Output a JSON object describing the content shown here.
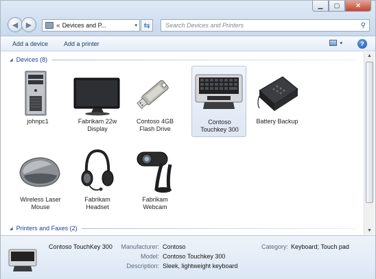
{
  "address": {
    "path_separator": "«",
    "path_text": "Devices and P...",
    "dropdown_glyph": "▾"
  },
  "search": {
    "placeholder": "Search Devices and Printers"
  },
  "toolbar": {
    "add_device": "Add a device",
    "add_printer": "Add a printer",
    "help_glyph": "?"
  },
  "groups": {
    "devices": "Devices (8)",
    "printers": "Printers and Faxes (2)"
  },
  "devices": [
    {
      "label": "johnpc1",
      "icon": "computer-tower-icon"
    },
    {
      "label": "Fabrikam 22w\nDisplay",
      "icon": "monitor-icon"
    },
    {
      "label": "Contoso 4GB\nFlash Drive",
      "icon": "usb-flash-drive-icon"
    },
    {
      "label": "Contoso\nTouchkey 300",
      "icon": "keyboard-icon",
      "selected": true
    },
    {
      "label": "Battery Backup",
      "icon": "ups-battery-icon"
    },
    {
      "label": "Wireless Laser\nMouse",
      "icon": "mouse-icon"
    },
    {
      "label": "Fabrikam\nHeadset",
      "icon": "headset-icon"
    },
    {
      "label": "Fabrikam\nWebcam",
      "icon": "webcam-icon"
    }
  ],
  "details": {
    "name": "Contoso TouchKey 300",
    "manufacturer_label": "Manufacturer:",
    "manufacturer": "Contoso",
    "model_label": "Model:",
    "model": "Contoso Touchkey 300",
    "description_label": "Description:",
    "description": "Sleek, lightweight keyboard",
    "category_label": "Category:",
    "category": "Keyboard; Touch pad"
  },
  "colors": {
    "link_blue": "#1c3f94",
    "selection_bg": "#dfe7f3",
    "details_bg": "#dce7f4"
  }
}
